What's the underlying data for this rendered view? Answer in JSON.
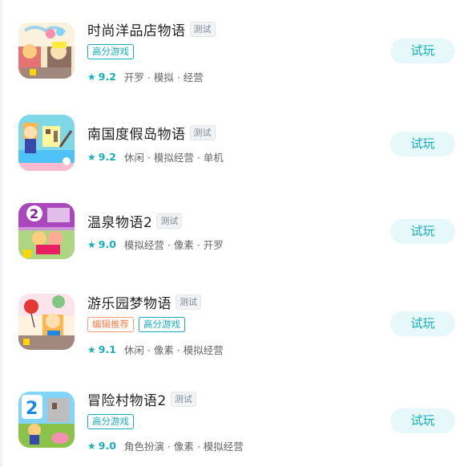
{
  "games": [
    {
      "title": "时尚洋品店物语",
      "badge": "测试",
      "tags": [
        {
          "label": "高分游戏",
          "style": "teal"
        }
      ],
      "rating": "9.2",
      "genres": "开罗 · 模拟 · 经营",
      "button": "试玩",
      "icon": "fashion-shop-icon"
    },
    {
      "title": "南国度假岛物语",
      "badge": "测试",
      "tags": [],
      "rating": "9.2",
      "genres": "休闲 · 模拟经营 · 单机",
      "button": "试玩",
      "icon": "island-resort-icon"
    },
    {
      "title": "温泉物语2",
      "badge": "测试",
      "tags": [],
      "rating": "9.0",
      "genres": "模拟经营 · 像素 · 开罗",
      "button": "试玩",
      "icon": "hot-spring-icon"
    },
    {
      "title": "游乐园梦物语",
      "badge": "测试",
      "tags": [
        {
          "label": "编辑推荐",
          "style": "orange"
        },
        {
          "label": "高分游戏",
          "style": "teal"
        }
      ],
      "rating": "9.1",
      "genres": "休闲 · 像素 · 模拟经营",
      "button": "试玩",
      "icon": "amusement-park-icon"
    },
    {
      "title": "冒险村物语2",
      "badge": "测试",
      "tags": [
        {
          "label": "高分游戏",
          "style": "teal"
        }
      ],
      "rating": "9.0",
      "genres": "角色扮演 · 像素 · 模拟经营",
      "button": "试玩",
      "icon": "adventure-village-icon"
    }
  ],
  "colors": {
    "accent": "#14aebd",
    "accent_bg": "#e6f8fa",
    "orange": "#ff7a45"
  }
}
